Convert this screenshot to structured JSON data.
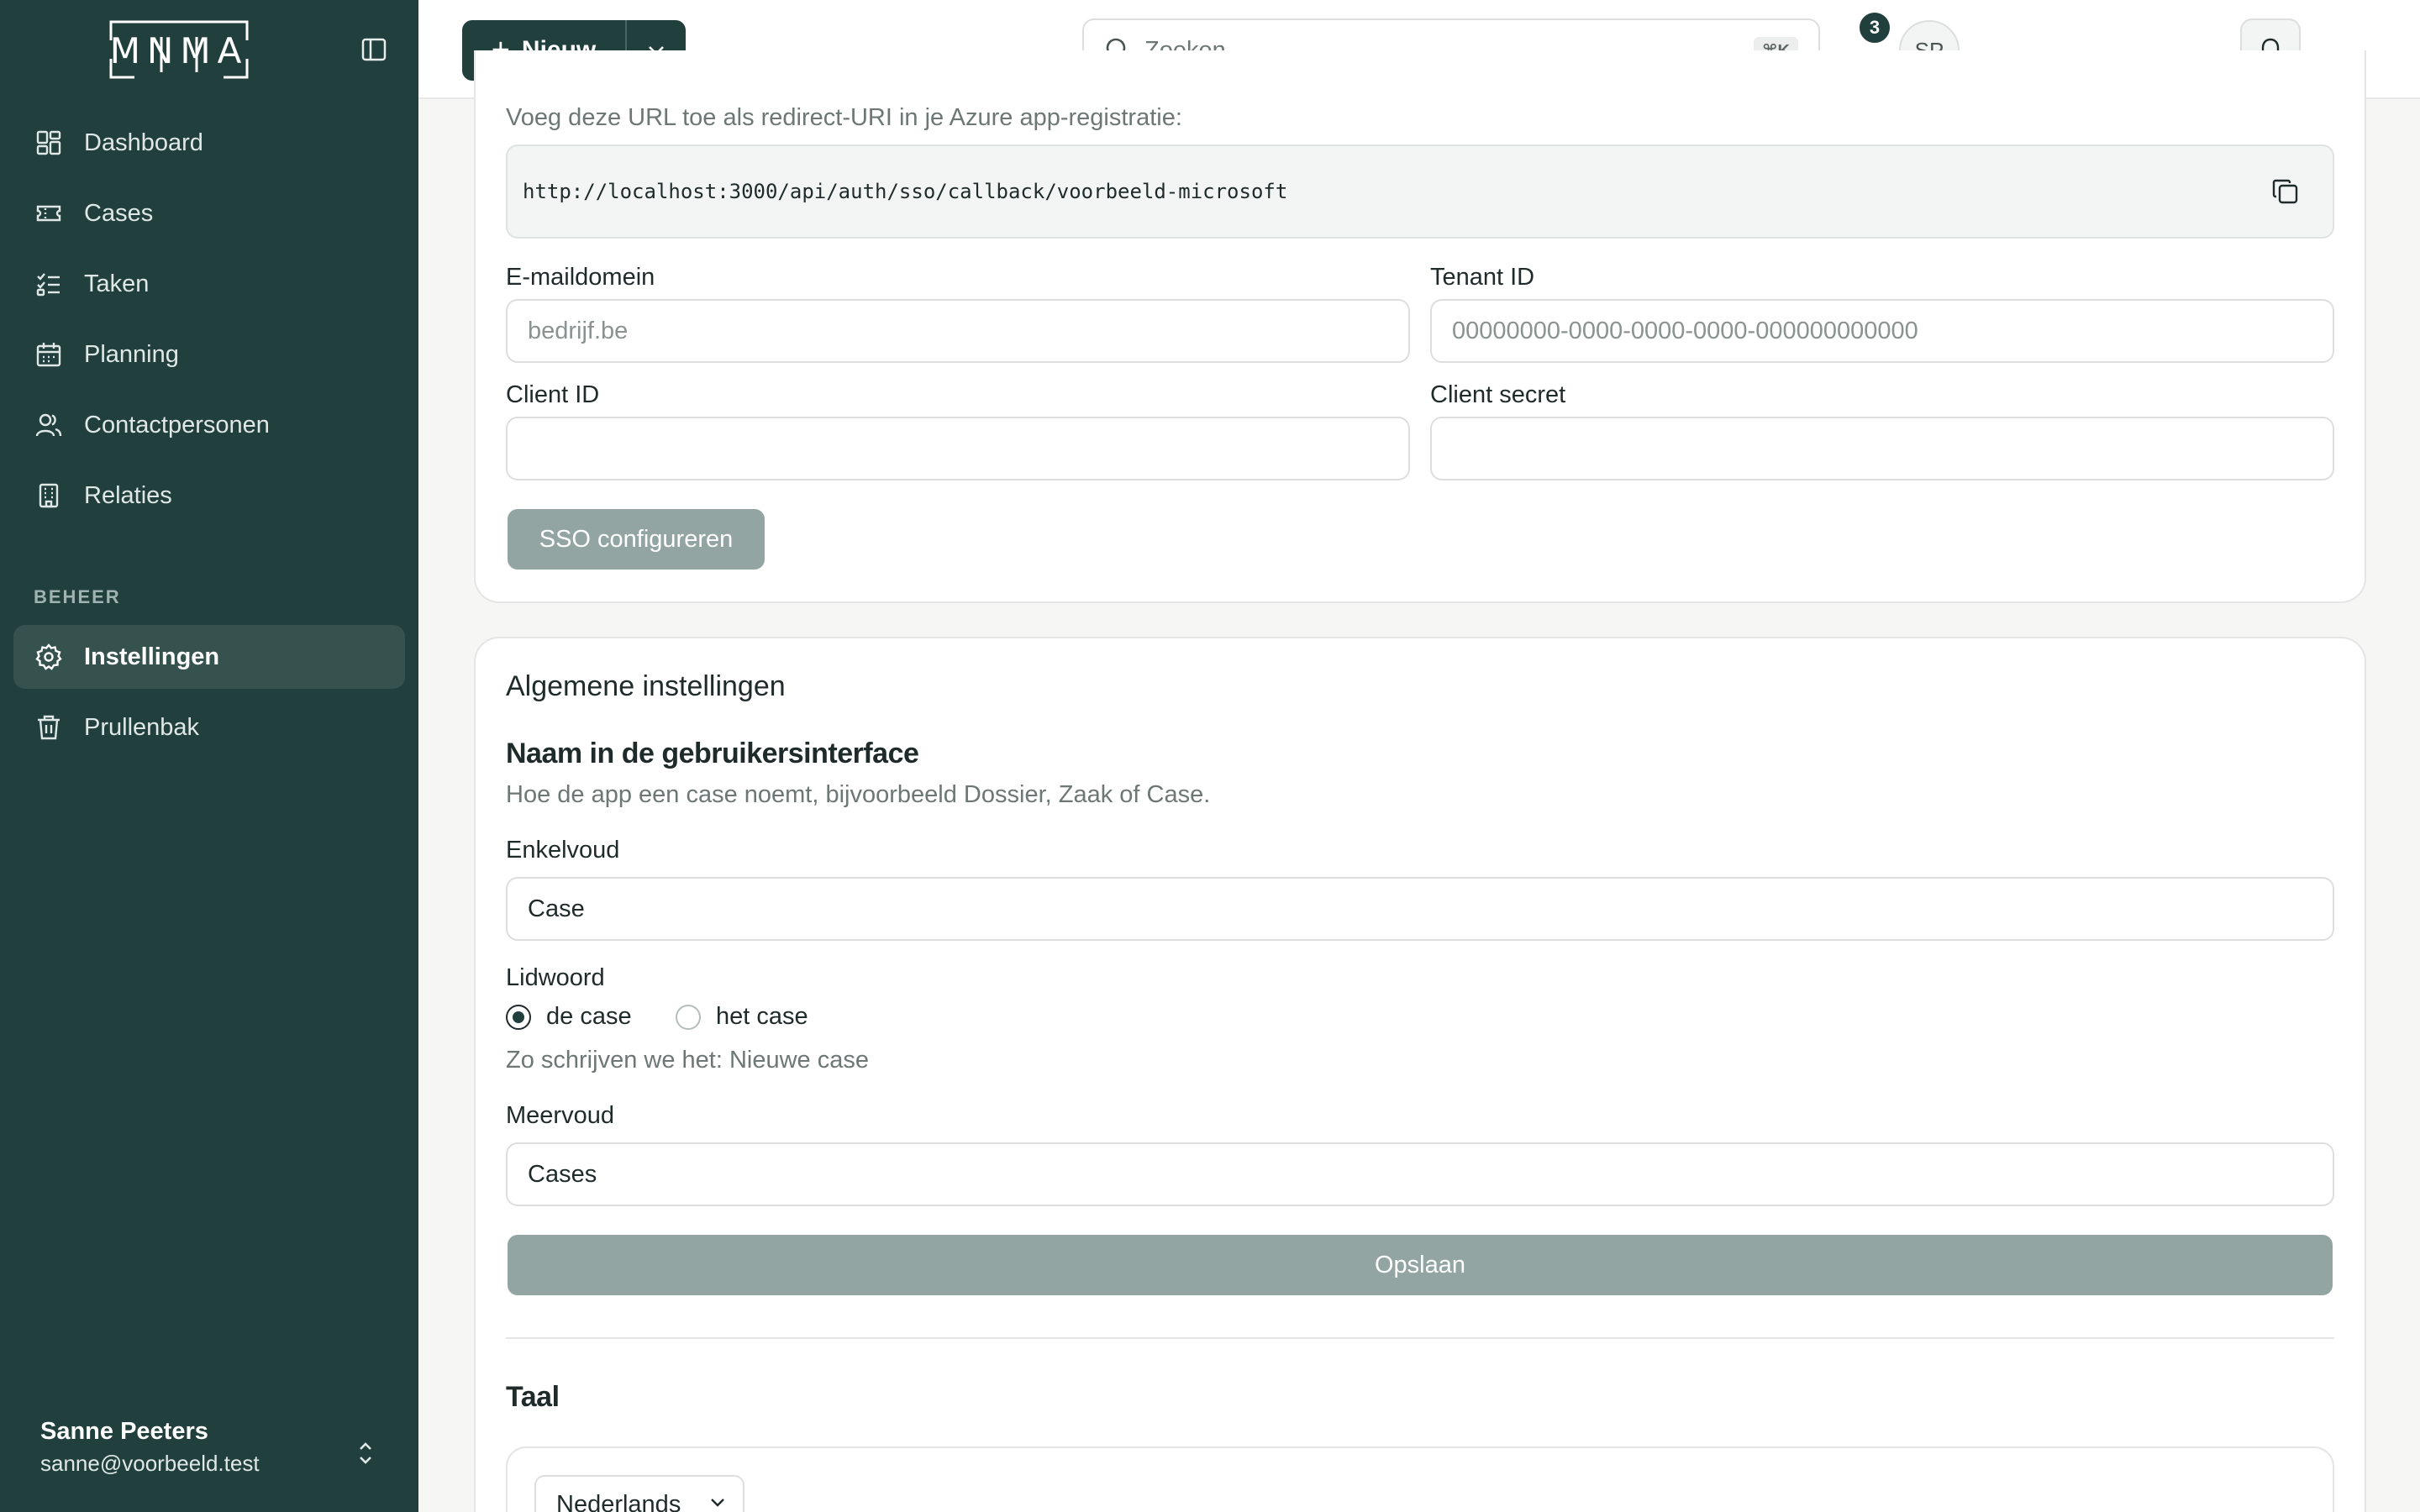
{
  "app": {
    "logo_text": "MNMA"
  },
  "sidebar": {
    "items": [
      {
        "label": "Dashboard",
        "icon": "dashboard-icon"
      },
      {
        "label": "Cases",
        "icon": "ticket-icon"
      },
      {
        "label": "Taken",
        "icon": "tasks-icon"
      },
      {
        "label": "Planning",
        "icon": "calendar-icon"
      },
      {
        "label": "Contactpersonen",
        "icon": "users-icon"
      },
      {
        "label": "Relaties",
        "icon": "building-icon"
      }
    ],
    "section_label": "BEHEER",
    "admin_items": [
      {
        "label": "Instellingen",
        "icon": "gear-icon",
        "active": true
      },
      {
        "label": "Prullenbak",
        "icon": "trash-icon"
      }
    ],
    "user": {
      "name": "Sanne Peeters",
      "email": "sanne@voorbeeld.test"
    }
  },
  "topbar": {
    "new_label": "Nieuw",
    "search_placeholder": "Zoeken...",
    "search_shortcut": "⌘K",
    "notification_count": "3",
    "avatar_initials": "SP"
  },
  "sso": {
    "redirect_hint": "Voeg deze URL toe als redirect-URI in je Azure app-registratie:",
    "redirect_url": "http://localhost:3000/api/auth/sso/callback/voorbeeld-microsoft",
    "email_domain_label": "E-maildomein",
    "email_domain_placeholder": "bedrijf.be",
    "tenant_label": "Tenant ID",
    "tenant_placeholder": "00000000-0000-0000-0000-000000000000",
    "client_id_label": "Client ID",
    "client_secret_label": "Client secret",
    "submit_label": "SSO configureren"
  },
  "general": {
    "title": "Algemene instellingen",
    "ui_name_heading": "Naam in de gebruikersinterface",
    "ui_name_hint": "Hoe de app een case noemt, bijvoorbeeld Dossier, Zaak of Case.",
    "singular_label": "Enkelvoud",
    "singular_value": "Case",
    "article_label": "Lidwoord",
    "article_options": [
      "de case",
      "het case"
    ],
    "article_selected": "de case",
    "preview_text": "Zo schrijven we het: Nieuwe case",
    "plural_label": "Meervoud",
    "plural_value": "Cases",
    "save_label": "Opslaan",
    "language_heading": "Taal",
    "language_value": "Nederlands"
  },
  "colors": {
    "sidebar_bg": "#213f3c",
    "primary": "#213f3c",
    "disabled_button": "#93a5a2"
  }
}
